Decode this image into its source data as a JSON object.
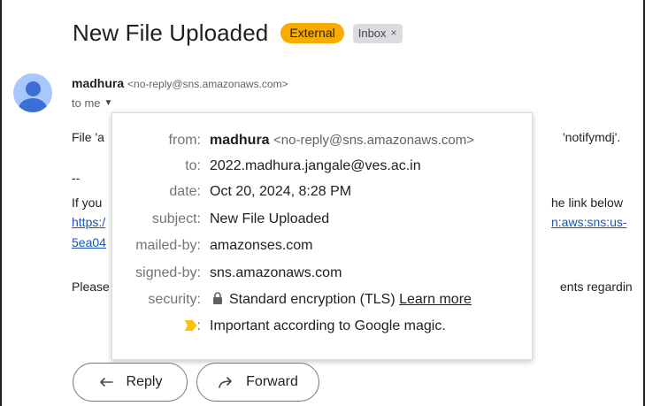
{
  "email": {
    "subject": "New File Uploaded",
    "labels": {
      "external": "External",
      "inbox": "Inbox"
    },
    "sender": {
      "name": "madhura",
      "email": "<no-reply@sns.amazonaws.com>"
    },
    "to_line": "to me",
    "body": {
      "line1_left": "File 'a",
      "line1_right": "'notifymdj'.",
      "separator": "--",
      "line2_left": "If you",
      "line2_right": "he link below",
      "link1_left": "https:/",
      "link1_right": "n:aws:sns:us-",
      "link2_left": "5ea04",
      "line4_left": "Please",
      "line4_right": "ents regardin"
    }
  },
  "details_popup": {
    "rows": [
      {
        "label": "from:",
        "name": "madhura",
        "value": "<no-reply@sns.amazonaws.com>"
      },
      {
        "label": "to:",
        "value": "2022.madhura.jangale@ves.ac.in"
      },
      {
        "label": "date:",
        "value": "Oct 20, 2024, 8:28 PM"
      },
      {
        "label": "subject:",
        "value": "New File Uploaded"
      },
      {
        "label": "mailed-by:",
        "value": "amazonses.com"
      },
      {
        "label": "signed-by:",
        "value": "sns.amazonaws.com"
      },
      {
        "label": "security:",
        "value": "Standard encryption (TLS)",
        "link": "Learn more"
      },
      {
        "label": ":",
        "value": "Important according to Google magic."
      }
    ]
  },
  "actions": {
    "reply": "Reply",
    "forward": "Forward"
  },
  "colors": {
    "external_badge": "#f9ab00",
    "link": "#1a55b8",
    "importance_marker": "#f9c300"
  },
  "icons": [
    "close-icon",
    "chevron-down-icon",
    "lock-icon",
    "importance-marker-icon",
    "reply-icon",
    "forward-icon"
  ]
}
